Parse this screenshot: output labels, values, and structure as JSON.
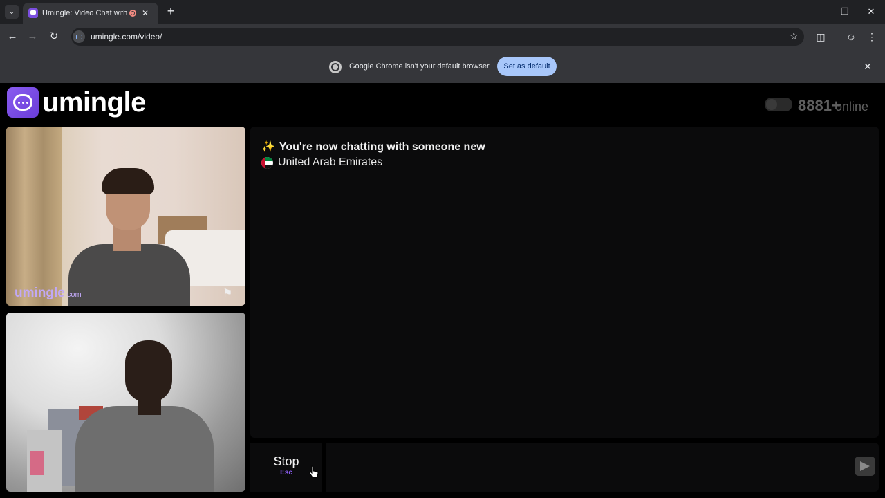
{
  "browser": {
    "tab_title": "Umingle: Video Chat with Strangers",
    "new_tab_icon": "+",
    "url": "umingle.com/video/",
    "infobar_text": "Google Chrome isn't your default browser",
    "set_default_label": "Set as default"
  },
  "header": {
    "logo_text": "umingle",
    "online_count": "8881+",
    "online_label": "online"
  },
  "stranger_video": {
    "watermark": "umingle",
    "watermark_suffix": ".com"
  },
  "chat": {
    "status_message": "You're now chatting with someone new",
    "sparkle_icon": "✨",
    "country": "United Arab Emirates"
  },
  "controls": {
    "stop_label": "Stop",
    "stop_hint": "Esc",
    "message_placeholder": ""
  },
  "colors": {
    "accent": "#8a5cf0",
    "set_default_bg": "#a8c7fa"
  }
}
